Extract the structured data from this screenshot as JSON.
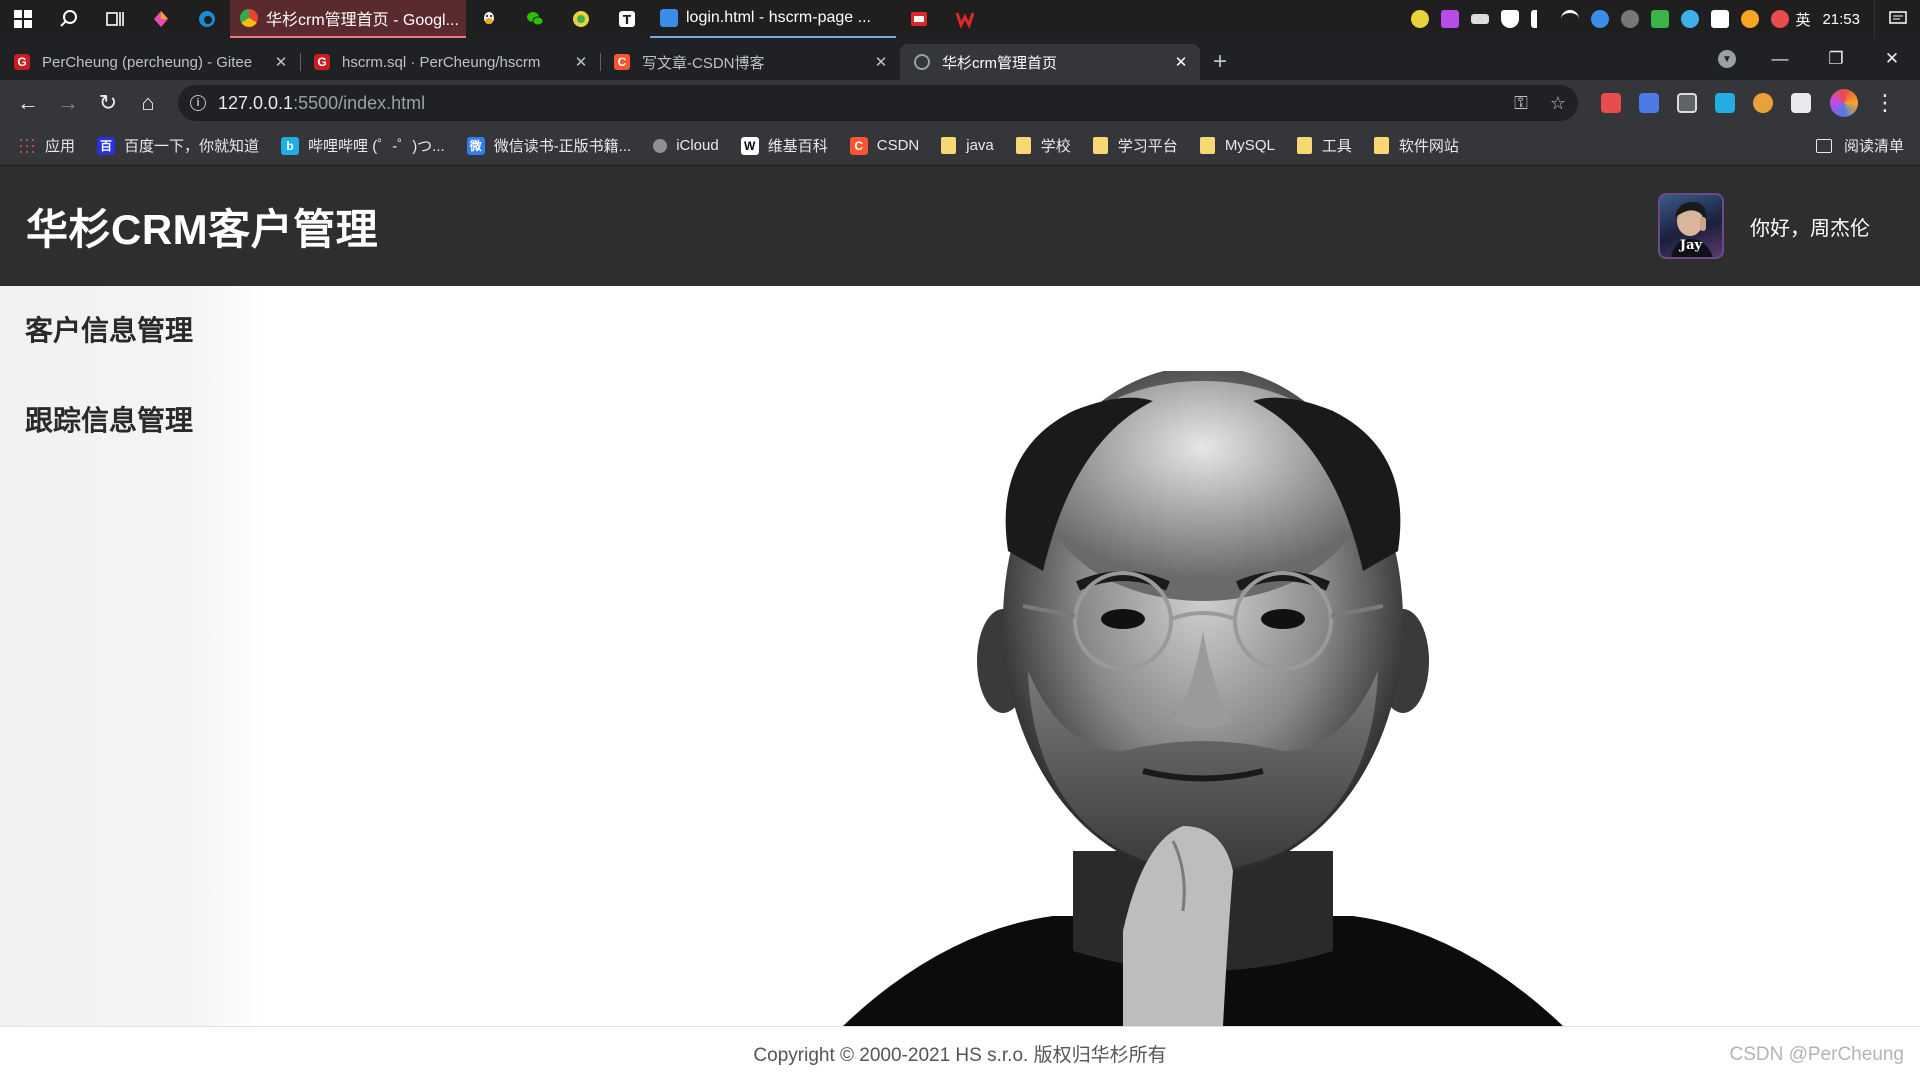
{
  "taskbar": {
    "apps": [
      {
        "label": "华杉crm管理首页 - Googl...",
        "color": "#e9a23b"
      },
      {
        "label": "login.html - hscrm-page ...",
        "color": "#3b8de9"
      }
    ],
    "tray": {
      "ime": "英",
      "time": "21:53"
    }
  },
  "tabs": [
    {
      "title": "PerCheung (percheung) - Gitee",
      "fav_text": "G",
      "fav_color": "#c71d23"
    },
    {
      "title": "hscrm.sql · PerCheung/hscrm",
      "fav_text": "G",
      "fav_color": "#c71d23"
    },
    {
      "title": "写文章-CSDN博客",
      "fav_text": "C",
      "fav_color": "#fc5531"
    },
    {
      "title": "华杉crm管理首页",
      "fav_text": "",
      "fav_color": "#9aa0a6"
    }
  ],
  "toolbar": {
    "url_host": "127.0.0.1",
    "url_path": ":5500/index.html"
  },
  "bookmarks": [
    {
      "label": "应用",
      "kind": "apps"
    },
    {
      "label": "百度一下，你就知道",
      "kind": "icon",
      "color": "#2932e1",
      "text": "百"
    },
    {
      "label": "哔哩哔哩 (゜-゜)つ...",
      "kind": "icon",
      "color": "#23ade5",
      "text": "b"
    },
    {
      "label": "微信读书-正版书籍...",
      "kind": "icon",
      "color": "#2f7cf6",
      "text": "微"
    },
    {
      "label": "iCloud",
      "kind": "icon",
      "color": "#8e8e93",
      "text": ""
    },
    {
      "label": "维基百科",
      "kind": "icon",
      "color": "#ffffff",
      "text": "W"
    },
    {
      "label": "CSDN",
      "kind": "icon",
      "color": "#fc5531",
      "text": "C"
    },
    {
      "label": "java",
      "kind": "folder"
    },
    {
      "label": "学校",
      "kind": "folder"
    },
    {
      "label": "学习平台",
      "kind": "folder"
    },
    {
      "label": "MySQL",
      "kind": "folder"
    },
    {
      "label": "工具",
      "kind": "folder"
    },
    {
      "label": "软件网站",
      "kind": "folder"
    }
  ],
  "reading_list": "阅读清单",
  "app": {
    "title": "华杉CRM客户管理",
    "greeting": "你好，周杰伦",
    "avatar_caption": "Jay"
  },
  "sidebar": {
    "items": [
      {
        "label": "客户信息管理"
      },
      {
        "label": "跟踪信息管理"
      }
    ]
  },
  "footer": {
    "copyright": "Copyright © 2000-2021 HS s.r.o. 版权归华杉所有"
  },
  "watermark": "CSDN @PerCheung"
}
